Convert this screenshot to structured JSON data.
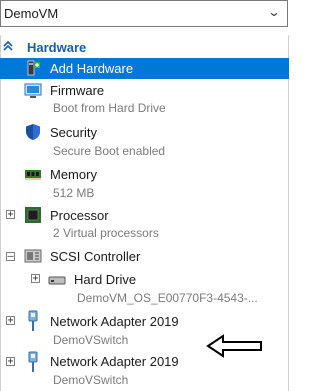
{
  "vm_selector": {
    "value": "DemoVM"
  },
  "hardware": {
    "title": "Hardware",
    "items": [
      {
        "label": "Add Hardware",
        "sub": ""
      },
      {
        "label": "Firmware",
        "sub": "Boot from Hard Drive"
      },
      {
        "label": "Security",
        "sub": "Secure Boot enabled"
      },
      {
        "label": "Memory",
        "sub": "512 MB"
      },
      {
        "label": "Processor",
        "sub": "2 Virtual processors"
      },
      {
        "label": "SCSI Controller",
        "sub": ""
      },
      {
        "label": "Hard Drive",
        "sub": "DemoVM_OS_E00770F3-4543-..."
      },
      {
        "label": "Network Adapter 2019",
        "sub": "DemoVSwitch"
      },
      {
        "label": "Network Adapter 2019",
        "sub": "DemoVSwitch"
      }
    ]
  },
  "icons": {
    "add_hardware": "add-hardware-icon",
    "firmware": "firmware-monitor-icon",
    "security": "shield-icon",
    "memory": "memory-chip-icon",
    "processor": "processor-icon",
    "scsi": "scsi-controller-icon",
    "hard_drive": "hard-drive-icon",
    "network": "network-adapter-icon",
    "annotation": "arrow-left-icon"
  },
  "colors": {
    "selection": "#0078d7",
    "section_header": "#1f5a9e",
    "subtext": "#7b7b7b"
  }
}
